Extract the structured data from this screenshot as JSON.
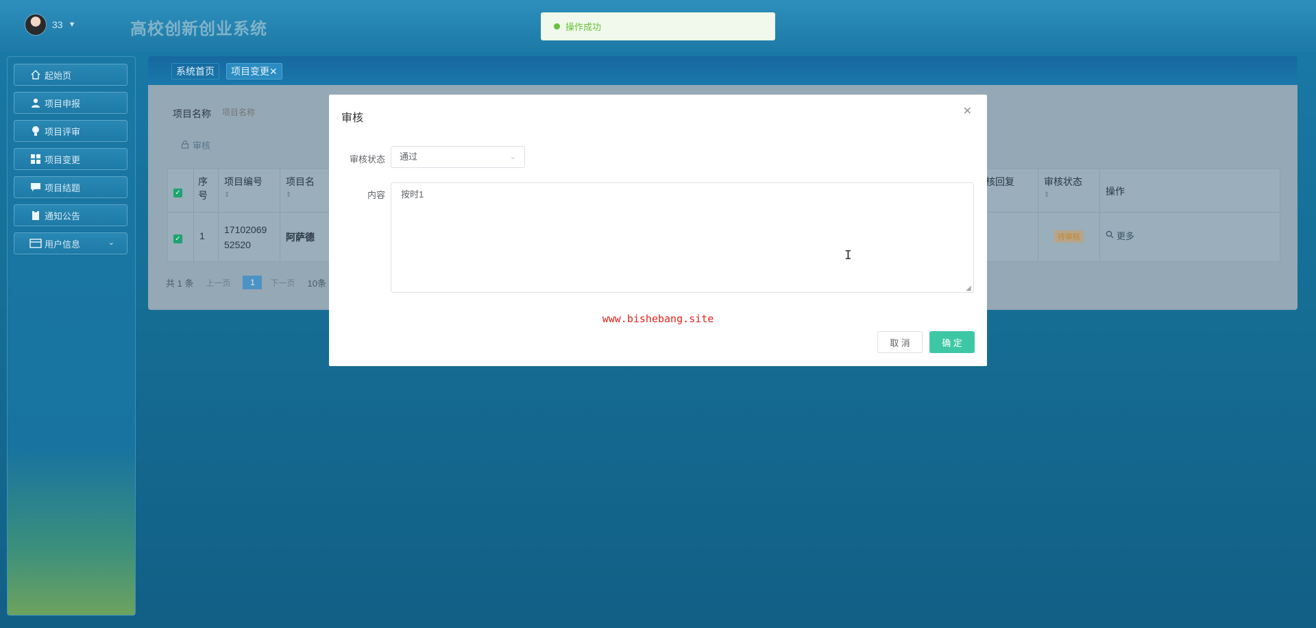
{
  "header": {
    "username": "33",
    "system_title": "高校创新创业系统"
  },
  "sidebar": {
    "items": [
      {
        "label": "起始页",
        "icon": "home-icon"
      },
      {
        "label": "项目申报",
        "icon": "user-icon"
      },
      {
        "label": "项目评审",
        "icon": "bulb-icon"
      },
      {
        "label": "项目变更",
        "icon": "grid-icon"
      },
      {
        "label": "项目结题",
        "icon": "chat-icon"
      },
      {
        "label": "通知公告",
        "icon": "clipboard-icon"
      },
      {
        "label": "用户信息",
        "icon": "wallet-icon"
      }
    ]
  },
  "tabs": [
    {
      "label": "系统首页"
    },
    {
      "label": "项目变更✕"
    }
  ],
  "search": {
    "label": "项目名称",
    "placeholder": "项目名称"
  },
  "toolbar": {
    "audit_label": "审核"
  },
  "table": {
    "headers": [
      "序号",
      "项目编号",
      "项目名",
      "核回复",
      "审核状态",
      "操作"
    ],
    "row": {
      "index": "1",
      "project_code": "17102069 52520",
      "project_name": "阿萨德",
      "status": "待审核",
      "action": "更多"
    }
  },
  "pager": {
    "total": "共 1 条",
    "prev": "上一页",
    "current": "1",
    "next": "下一页",
    "page_size": "10条"
  },
  "modal": {
    "title": "审核",
    "status_label": "审核状态",
    "status_value": "通过",
    "content_label": "内容",
    "content_value": "按时1",
    "watermark": "www.bishebang.site",
    "cancel_label": "取 消",
    "ok_label": "确 定"
  },
  "toast": {
    "message": "操作成功"
  },
  "colors": {
    "accent_green": "#3ec7a5",
    "success": "#67c23a",
    "watermark_red": "#e2231a"
  }
}
